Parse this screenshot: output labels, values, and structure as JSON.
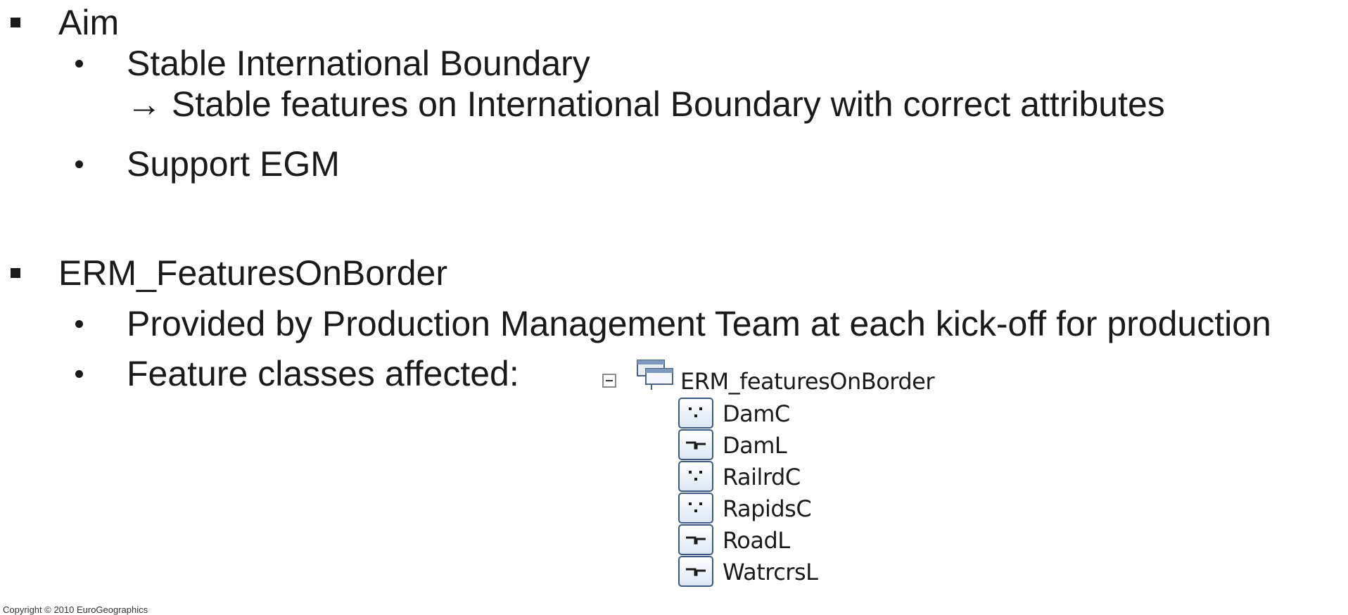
{
  "sections": [
    {
      "heading": "Aim",
      "items": [
        {
          "text": "Stable International Boundary",
          "continuation": "→ Stable features on International Boundary with correct attributes"
        },
        {
          "text": "Support EGM"
        }
      ]
    },
    {
      "heading": "ERM_FeaturesOnBorder",
      "items": [
        {
          "text": "Provided by Production Management Team at each kick-off for production"
        },
        {
          "text": "Feature classes affected:"
        }
      ]
    }
  ],
  "tree": {
    "root": {
      "label": "ERM_featuresOnBorder",
      "icon": "feature-dataset-icon",
      "expanded": true
    },
    "children": [
      {
        "label": "DamC",
        "icon": "point-feature-class-icon"
      },
      {
        "label": "DamL",
        "icon": "line-feature-class-icon"
      },
      {
        "label": "RailrdC",
        "icon": "point-feature-class-icon"
      },
      {
        "label": "RapidsC",
        "icon": "point-feature-class-icon"
      },
      {
        "label": "RoadL",
        "icon": "line-feature-class-icon"
      },
      {
        "label": "WatrcrsL",
        "icon": "line-feature-class-icon"
      }
    ]
  },
  "footer": "Copyright © 2010 EuroGeographics"
}
